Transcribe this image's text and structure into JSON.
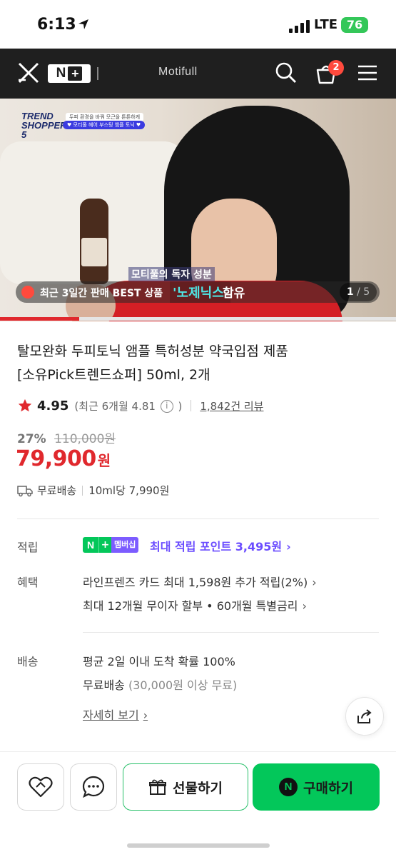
{
  "status": {
    "time": "6:13",
    "network": "LTE",
    "battery": "76"
  },
  "header": {
    "brand": "Motifull",
    "cart_count": "2"
  },
  "hero": {
    "logo_text": "TREND SHOPPER 5",
    "pill1": "두피 환경을 바꿔 모근을 튼튼하게",
    "pill2": "♥ 모티풀 헤어 부스팅 앰플 토닉 ♥",
    "subtitle_top": "모티풀의 독자 성분",
    "banner_text": "최근 3일간 판매 BEST 상품",
    "subtitle_highlight": "'노제닉스'",
    "subtitle_end": "함유",
    "page_current": "1",
    "page_total": "/ 5",
    "progress_fraction": 0.2
  },
  "product": {
    "title_line1": "탈모완화 두피토닉 앰플 특허성분 약국입점 제품",
    "title_line2": "[소유Pick트렌드쇼퍼] 50ml, 2개",
    "rating": "4.95",
    "rating_recent_prefix": "(최근 6개월 4.81",
    "rating_recent_suffix": ")",
    "review_count": "1,842건 리뷰",
    "discount": "27%",
    "original_price": "110,000원",
    "price": "79,900",
    "price_unit": "원",
    "shipping": "무료배송",
    "unit_price": "10ml당 7,990원"
  },
  "details": {
    "points_label": "적립",
    "membership_tag": "멤버십",
    "points_text": "최대 적립 포인트 3,495원",
    "benefit_label": "혜택",
    "benefit_line1": "라인프렌즈 카드 최대 1,598원 추가 적립(2%)",
    "benefit_line2": "최대 12개월 무이자 할부 • 60개월 특별금리",
    "delivery_label": "배송",
    "delivery_line1": "평균 2일 이내 도착 확률 100%",
    "delivery_line2_main": "무료배송",
    "delivery_line2_sub": "(30,000원 이상 무료)",
    "detail_link": "자세히 보기"
  },
  "actions": {
    "gift_label": "선물하기",
    "buy_label": "구매하기"
  },
  "colors": {
    "accent_red": "#e0282d",
    "naver_green": "#03c75a",
    "membership_purple": "#6b4dff"
  },
  "icons": [
    "close-icon",
    "search-icon",
    "cart-icon",
    "menu-icon",
    "star-icon",
    "info-icon",
    "truck-icon",
    "share-icon",
    "heart-icon",
    "chat-icon",
    "gift-icon"
  ]
}
